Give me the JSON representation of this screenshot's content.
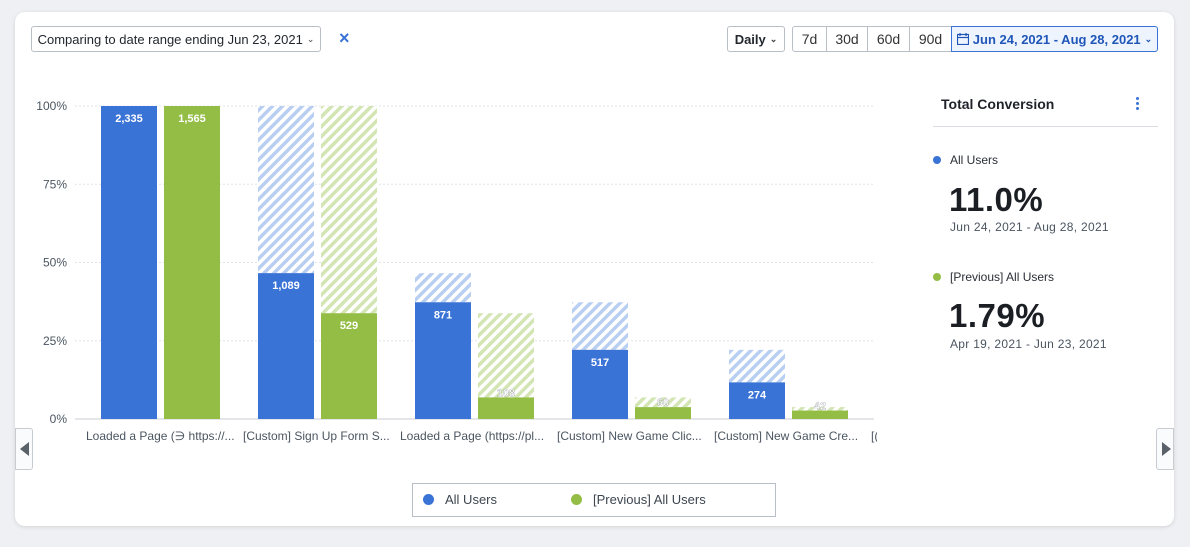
{
  "toolbar": {
    "compare_label": "Comparing to date range ending Jun 23, 2021",
    "clear_icon": "close-icon",
    "interval_label": "Daily",
    "ranges": [
      "7d",
      "30d",
      "60d",
      "90d"
    ],
    "date_range_label": "Jun 24, 2021 - Aug 28, 2021",
    "calendar_icon": "calendar-icon"
  },
  "sidebar": {
    "title": "Total Conversion",
    "menu_icon": "kebab-icon",
    "series": [
      {
        "name": "All Users",
        "value": "11.0%",
        "range": "Jun 24, 2021 - Aug 28, 2021",
        "color": "#3a73d6"
      },
      {
        "name": "[Previous] All Users",
        "value": "1.79%",
        "range": "Apr 19, 2021 - Jun 23, 2021",
        "color": "#94bd46"
      }
    ]
  },
  "legend": [
    {
      "label": "All Users",
      "color": "#3a73d6"
    },
    {
      "label": "[Previous] All Users",
      "color": "#94bd46"
    }
  ],
  "nav": {
    "prev_icon": "chevron-left-icon",
    "next_icon": "chevron-right-icon"
  },
  "colors": {
    "current": "#3a73d6",
    "previous": "#94bd46",
    "current_hatch": "#b9cff2",
    "previous_hatch": "#d2e5b3",
    "accent": "#3a73d6"
  },
  "chart_data": {
    "type": "bar",
    "categories": [
      "Loaded a Page (∋ https://...",
      "[Custom] Sign Up Form S...",
      "Loaded a Page (https://pl...",
      "[Custom] New Game Clic...",
      "[Custom] New Game Cre...",
      "[("
    ],
    "yticks": [
      "100%",
      "75%",
      "50%",
      "25%",
      "0%"
    ],
    "ylim": [
      0,
      100
    ],
    "grid": true,
    "legend_position": "bottom",
    "series": [
      {
        "name": "All Users",
        "values": [
          2335,
          1089,
          871,
          517,
          274
        ],
        "percent": [
          100,
          46.6,
          37.3,
          22.1,
          11.7
        ],
        "prev_step_percent": [
          100,
          100,
          46.6,
          37.3,
          22.1
        ]
      },
      {
        "name": "[Previous] All Users",
        "values": [
          1565,
          529,
          108,
          60,
          42
        ],
        "percent": [
          100,
          33.8,
          6.9,
          3.8,
          2.7
        ],
        "prev_step_percent": [
          100,
          100,
          33.8,
          6.9,
          3.8
        ]
      }
    ]
  }
}
